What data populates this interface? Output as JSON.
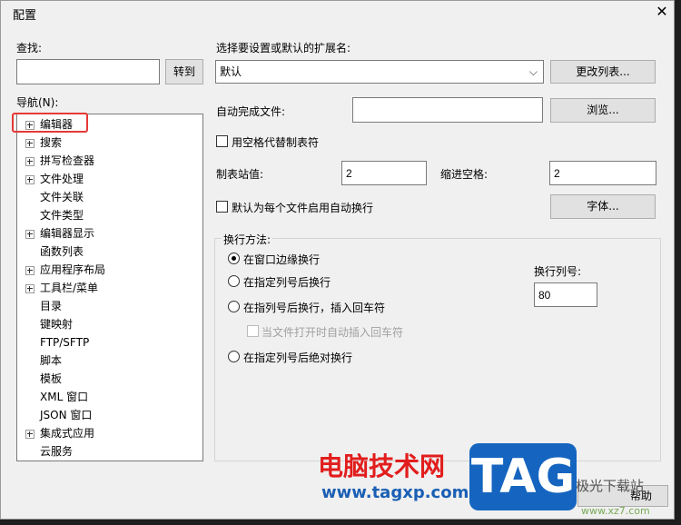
{
  "window": {
    "title": "配置",
    "close_glyph": "✕"
  },
  "left": {
    "find_label": "查找:",
    "find_value": "",
    "goto_button": "转到",
    "nav_label": "导航(N):",
    "nav_items": [
      {
        "label": "编辑器",
        "expandable": true
      },
      {
        "label": "搜索",
        "expandable": true
      },
      {
        "label": "拼写检查器",
        "expandable": true
      },
      {
        "label": "文件处理",
        "expandable": true
      },
      {
        "label": "文件关联",
        "expandable": false
      },
      {
        "label": "文件类型",
        "expandable": false
      },
      {
        "label": "编辑器显示",
        "expandable": true
      },
      {
        "label": "函数列表",
        "expandable": false
      },
      {
        "label": "应用程序布局",
        "expandable": true
      },
      {
        "label": "工具栏/菜单",
        "expandable": true
      },
      {
        "label": "目录",
        "expandable": false
      },
      {
        "label": "键映射",
        "expandable": false
      },
      {
        "label": "FTP/SFTP",
        "expandable": false
      },
      {
        "label": "脚本",
        "expandable": false
      },
      {
        "label": "模板",
        "expandable": false
      },
      {
        "label": "XML 窗口",
        "expandable": false
      },
      {
        "label": "JSON 窗口",
        "expandable": false
      },
      {
        "label": "集成式应用",
        "expandable": true
      },
      {
        "label": "云服务",
        "expandable": false
      }
    ]
  },
  "right": {
    "ext_label": "选择要设置或默认的扩展名:",
    "ext_value": "默认",
    "change_list_button": "更改列表...",
    "autocomplete_label": "自动完成文件:",
    "autocomplete_value": "",
    "browse_button": "浏览...",
    "use_spaces_label": "用空格代替制表符",
    "tab_stop_label": "制表站值:",
    "tab_stop_value": "2",
    "indent_label": "缩进空格:",
    "indent_value": "2",
    "wrap_default_label": "默认为每个文件启用自动换行",
    "font_button": "字体...",
    "wrap_group_label": "换行方法:",
    "wrap_options": [
      {
        "label": "在窗口边缘换行",
        "checked": true
      },
      {
        "label": "在指定列号后换行",
        "checked": false
      },
      {
        "label": "在指列号后换行，插入回车符",
        "checked": false
      },
      {
        "label": "在指定列号后绝对换行",
        "checked": false
      }
    ],
    "auto_insert_cr_label": "当文件打开时自动插入回车符",
    "wrap_col_label": "换行列号:",
    "wrap_col_value": "80",
    "help_button": "帮助"
  },
  "watermark": {
    "cn": "电脑技术网",
    "url": "www.tagxp.com",
    "tag": "TAG",
    "brand": "极光下载站",
    "site": "www.xz7.com"
  },
  "colors": {
    "highlight": "#e53935",
    "watermark_red": "#e21d1d",
    "watermark_blue": "#1565c0"
  }
}
